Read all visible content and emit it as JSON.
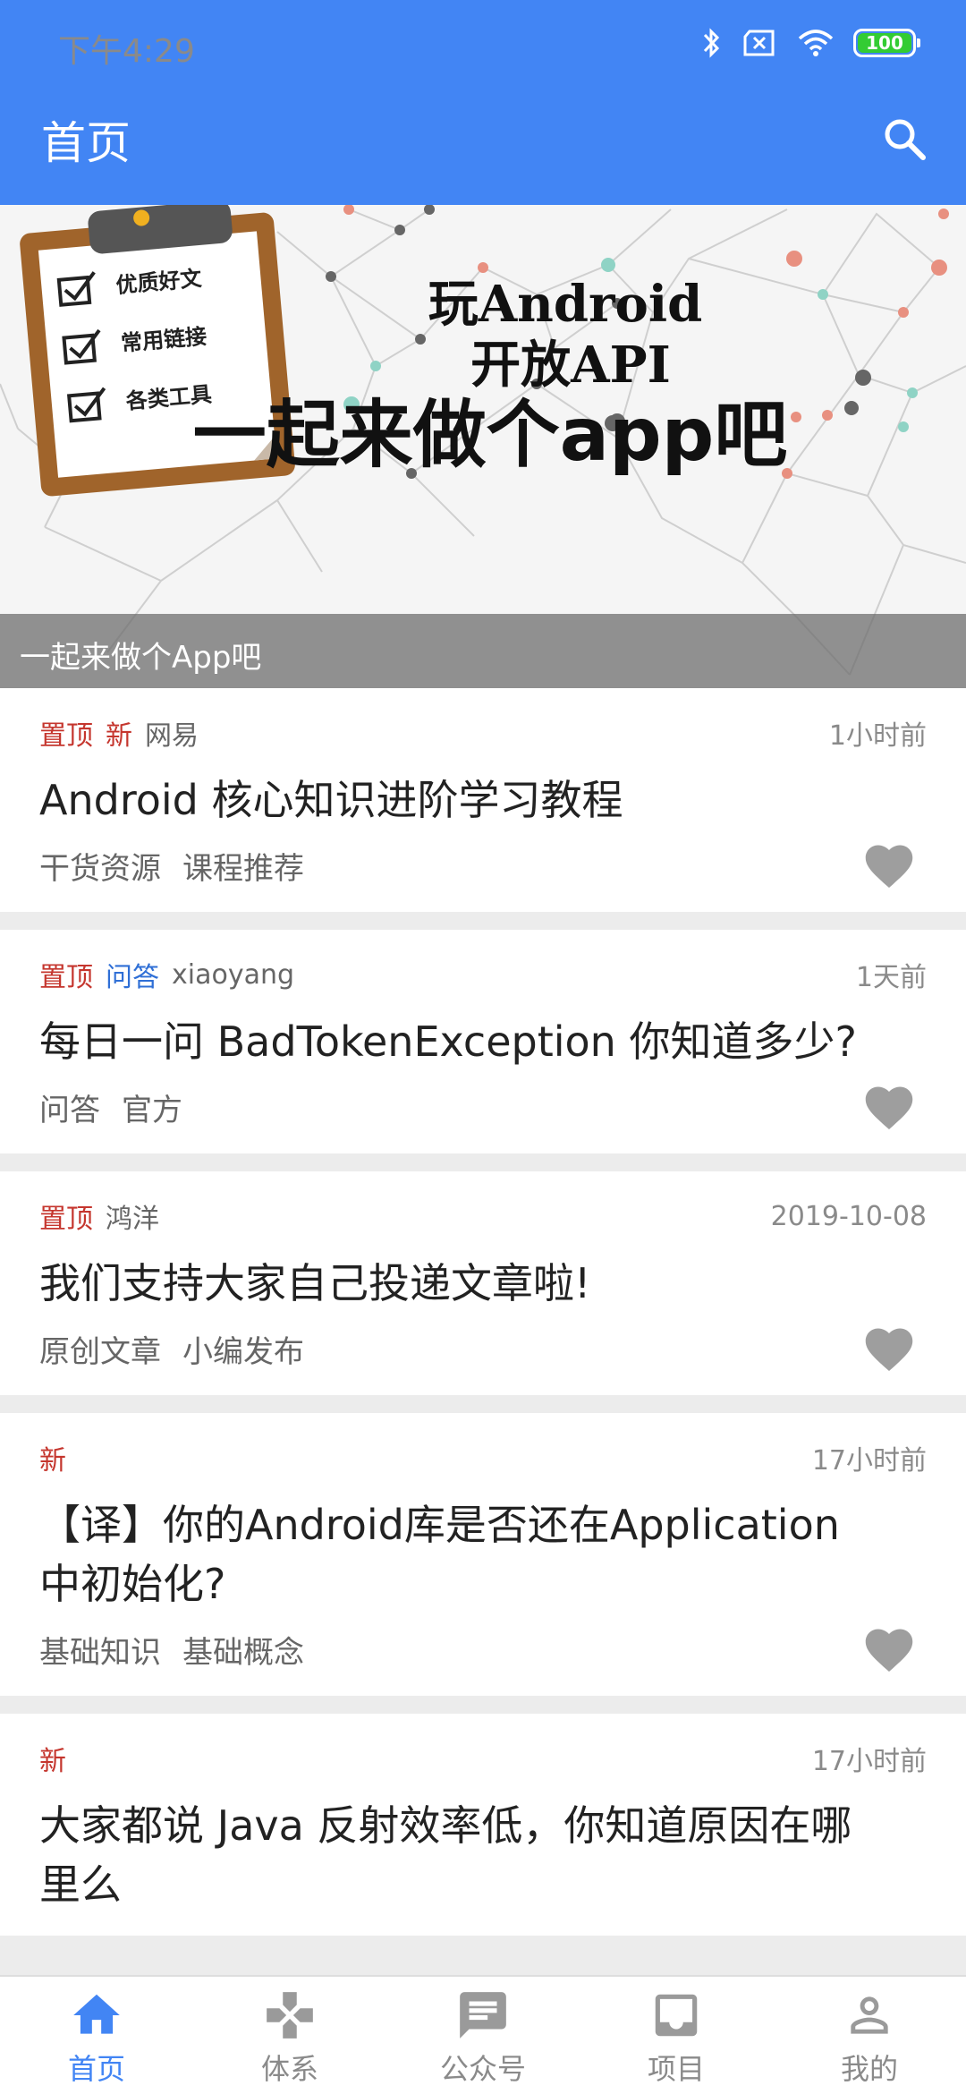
{
  "status_bar": {
    "time": "下午4:29",
    "battery": "100",
    "icons": [
      "bluetooth-icon",
      "no-sim-icon",
      "wifi-icon",
      "battery-icon"
    ]
  },
  "app_bar": {
    "title": "首页",
    "search_icon": "search-icon"
  },
  "banner": {
    "checklist": [
      "优质好文",
      "常用链接",
      "各类工具"
    ],
    "title_line1": "玩Android",
    "title_line2": "开放API",
    "slogan": "一起来做个app吧",
    "caption": "一起来做个App吧"
  },
  "articles": [
    {
      "tags": [
        {
          "text": "置顶",
          "color": "#c5362e"
        },
        {
          "text": "新",
          "color": "#c5362e"
        }
      ],
      "author": "网易",
      "time": "1小时前",
      "title": "Android 核心知识进阶学习教程",
      "chapters": [
        "干货资源",
        "课程推荐"
      ]
    },
    {
      "tags": [
        {
          "text": "置顶",
          "color": "#c5362e"
        },
        {
          "text": "问答",
          "color": "#2f6fd6"
        }
      ],
      "author": "xiaoyang",
      "time": "1天前",
      "title": "每日一问 BadTokenException 你知道多少?",
      "chapters": [
        "问答",
        "官方"
      ]
    },
    {
      "tags": [
        {
          "text": "置顶",
          "color": "#c5362e"
        }
      ],
      "author": "鸿洋",
      "time": "2019-10-08",
      "title": "我们支持大家自己投递文章啦!",
      "chapters": [
        "原创文章",
        "小编发布"
      ]
    },
    {
      "tags": [
        {
          "text": "新",
          "color": "#c5362e"
        }
      ],
      "author": "",
      "time": "17小时前",
      "title": "【译】你的Android库是否还在Application中初始化?",
      "chapters": [
        "基础知识",
        "基础概念"
      ]
    },
    {
      "tags": [
        {
          "text": "新",
          "color": "#c5362e"
        }
      ],
      "author": "",
      "time": "17小时前",
      "title": "大家都说 Java 反射效率低，你知道原因在哪里么",
      "chapters": []
    }
  ],
  "bottom_nav": [
    {
      "label": "首页",
      "icon": "home-icon",
      "active": true
    },
    {
      "label": "体系",
      "icon": "gamepad-icon",
      "active": false
    },
    {
      "label": "公众号",
      "icon": "chat-icon",
      "active": false
    },
    {
      "label": "项目",
      "icon": "inbox-icon",
      "active": false
    },
    {
      "label": "我的",
      "icon": "person-icon",
      "active": false
    }
  ],
  "colors": {
    "primary": "#4285f4",
    "tag_red": "#c5362e",
    "tag_blue": "#2f6fd6",
    "heart": "#9e9e9e"
  }
}
